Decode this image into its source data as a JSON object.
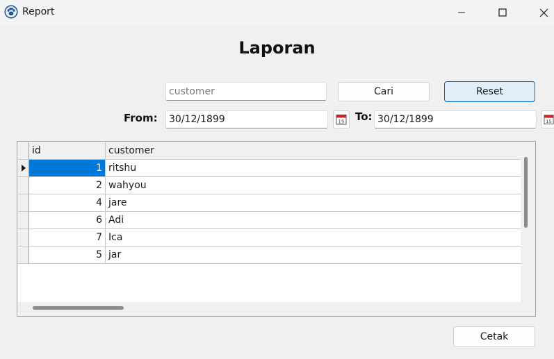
{
  "window": {
    "title": "Report",
    "icon": "paw-icon",
    "controls": [
      "minimize-icon",
      "maximize-icon",
      "close-icon"
    ]
  },
  "heading": "Laporan",
  "search": {
    "value": "",
    "placeholder": "customer"
  },
  "buttons": {
    "cari": "Cari",
    "reset": "Reset",
    "cetak": "Cetak"
  },
  "date_filter": {
    "from_label": "From:",
    "from_value": "30/12/1899",
    "to_label": "To:",
    "to_value": "30/12/1899",
    "calendar_icon": "calendar-icon",
    "calendar_day": "15"
  },
  "table": {
    "columns": [
      "id",
      "customer"
    ],
    "selected_row": 0,
    "rows": [
      {
        "id": "1",
        "customer": "ritshu"
      },
      {
        "id": "2",
        "customer": "wahyou"
      },
      {
        "id": "4",
        "customer": "jare"
      },
      {
        "id": "6",
        "customer": "Adi"
      },
      {
        "id": "7",
        "customer": "Ica"
      },
      {
        "id": "5",
        "customer": "jar"
      }
    ]
  },
  "colors": {
    "accent": "#0078d7",
    "focus_border": "#0067c0",
    "background": "#f0f0f0"
  }
}
